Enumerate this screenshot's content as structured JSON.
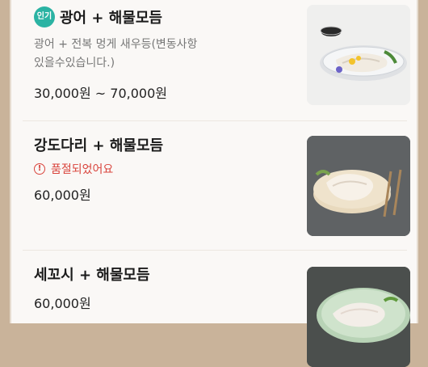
{
  "menu": {
    "items": [
      {
        "badge": "인기",
        "name": "광어 + 해물모듬",
        "desc_line1": "광어 + 전복 멍게 새우등(변동사항",
        "desc_line2": "있을수있습니다.)",
        "price": "30,000원 ~ 70,000원",
        "image_icon": "fish-platter-photo"
      },
      {
        "name": "강도다리 + 해물모듬",
        "status": "품절되었어요",
        "status_icon": "warning-circle-icon",
        "price": "60,000원",
        "image_icon": "fish-platter-photo"
      },
      {
        "name": "세꼬시 + 해물모듬",
        "price": "60,000원",
        "image_icon": "fish-platter-photo"
      }
    ]
  },
  "colors": {
    "accent_badge": "#2bb3a3",
    "soldout_red": "#d9443c",
    "background": "#faf8f6"
  }
}
